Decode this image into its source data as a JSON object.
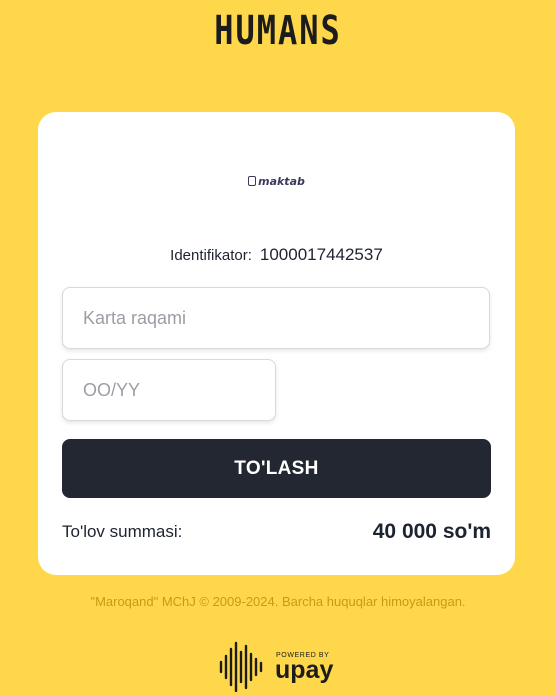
{
  "brand": {
    "name": "HUMANS"
  },
  "merchant": {
    "logo_text": "maktab"
  },
  "identifier": {
    "label": "Identifikator:",
    "value": "1000017442537"
  },
  "form": {
    "card_number_placeholder": "Karta raqami",
    "expiry_placeholder": "OO/YY",
    "pay_button_label": "TO'LASH"
  },
  "summary": {
    "label": "To'lov summasi:",
    "amount": "40 000 so'm"
  },
  "footer": {
    "copyright": "\"Maroqand\" MChJ © 2009-2024. Barcha huquqlar himoyalangan.",
    "powered_by": "POWERED BY",
    "provider": "upay"
  },
  "icons": {
    "merchant_logo": "maktab-logo-icon",
    "provider_logo": "sound-wave-icon"
  },
  "colors": {
    "background": "#FFD74A",
    "card": "#FFFFFF",
    "button": "#232732",
    "button_text": "#FFFFFF",
    "copyright_text": "#C99A16"
  }
}
